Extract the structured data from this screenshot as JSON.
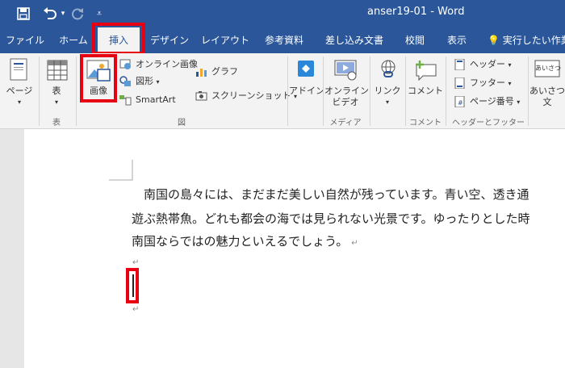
{
  "window": {
    "title": "anser19-01  -  Word"
  },
  "qat": {
    "save_icon": "save-icon",
    "undo_icon": "undo-icon",
    "redo_icon": "redo-icon",
    "customize_icon": "customize-qat-icon"
  },
  "tabs": [
    "ファイル",
    "ホーム",
    "挿入",
    "デザイン",
    "レイアウト",
    "参考資料",
    "差し込み文書",
    "校閲",
    "表示"
  ],
  "tell_me": "実行したい作業",
  "ribbon": {
    "pages": "ページ",
    "table": "表",
    "picture": "画像",
    "online_picture": "オンライン画像",
    "shapes": "図形",
    "smartart": "SmartArt",
    "chart": "グラフ",
    "screenshot": "スクリーンショット",
    "addin": "アドイン",
    "online_video_1": "オンライン",
    "online_video_2": "ビデオ",
    "link": "リンク",
    "comment": "コメント",
    "header": "ヘッダー",
    "footer": "フッター",
    "page_number": "ページ番号",
    "greeting_1": "あいさつ",
    "greeting_2": "文",
    "groups": {
      "table": "表",
      "illustrations": "図",
      "media": "メディア",
      "comments": "コメント",
      "header_footer": "ヘッダーとフッター"
    }
  },
  "document": {
    "lines": [
      "　南国の島々には、まだまだ美しい自然が残っています。青い空、透き通",
      "遊ぶ熱帯魚。どれも都会の海では見られない光景です。ゆったりとした時",
      "南国ならではの魅力といえるでしょう。"
    ],
    "para_mark": "↵"
  },
  "colors": {
    "accent": "#2b579a",
    "highlight": "#e60012"
  }
}
